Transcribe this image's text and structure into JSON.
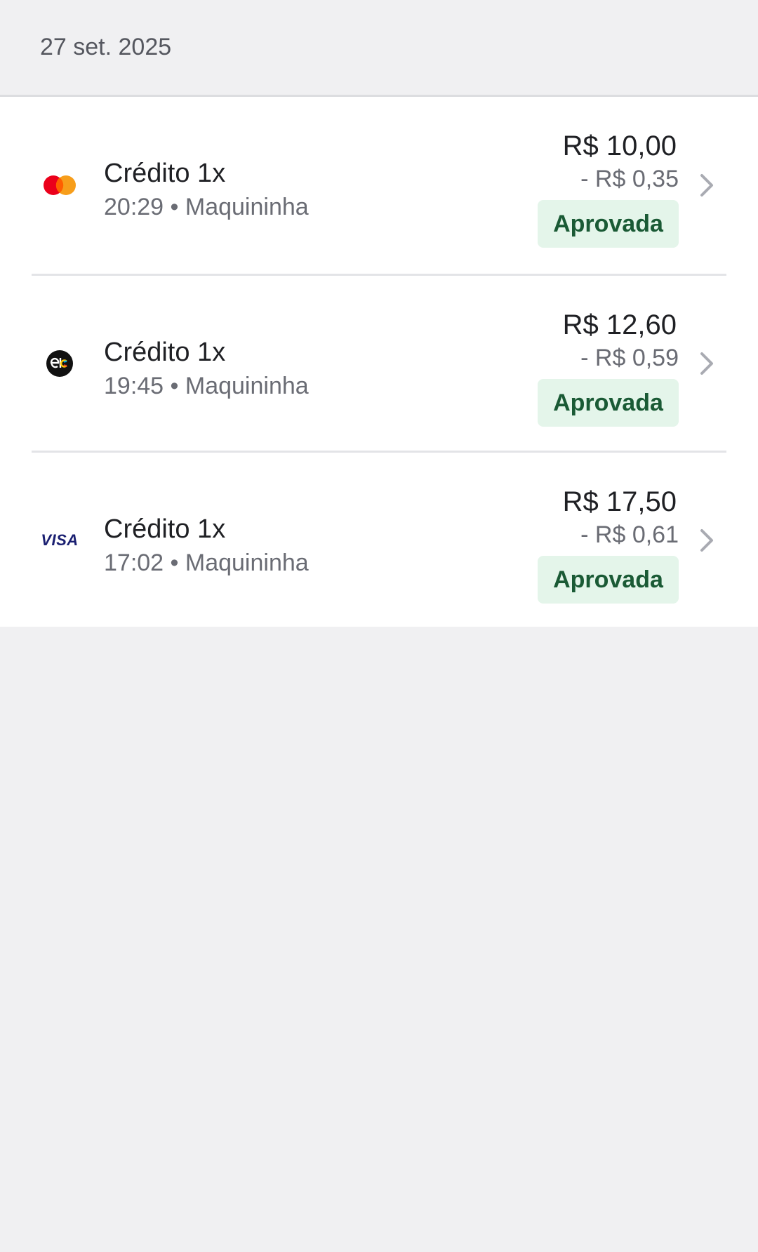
{
  "header": {
    "date": "27 set. 2025"
  },
  "transactions": [
    {
      "brand": "mastercard-icon",
      "title": "Crédito 1x",
      "subtitle": "20:29 • Maquininha",
      "amount": "R$ 10,00",
      "fee": "- R$ 0,35",
      "status": "Aprovada"
    },
    {
      "brand": "elo-icon",
      "title": "Crédito 1x",
      "subtitle": "19:45 • Maquininha",
      "amount": "R$ 12,60",
      "fee": "- R$ 0,59",
      "status": "Aprovada"
    },
    {
      "brand": "visa-icon",
      "title": "Crédito 1x",
      "subtitle": "17:02 • Maquininha",
      "amount": "R$ 17,50",
      "fee": "- R$ 0,61",
      "status": "Aprovada"
    }
  ],
  "brands": {
    "visa_label": "VISA"
  },
  "colors": {
    "status_bg": "#e4f5ea",
    "status_text": "#1a5a35",
    "mastercard_red": "#eb001b",
    "mastercard_orange": "#f79e1b",
    "visa_blue": "#1a1f71"
  }
}
